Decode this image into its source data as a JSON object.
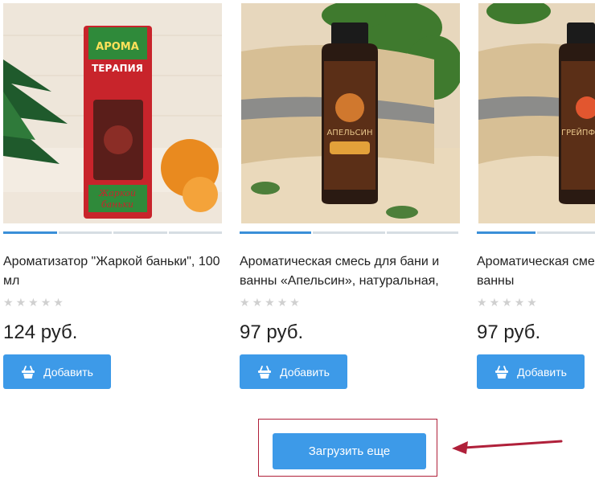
{
  "products": [
    {
      "title": "Ароматизатор \"Жаркой баньки\", 100 мл",
      "price": "124 руб.",
      "rating": 0,
      "add_label": "Добавить",
      "image": "aroma-box-with-tangerine-photo",
      "package_text": [
        "АРОМА",
        "ТЕРАПИЯ",
        "Жаркой",
        "баньки"
      ]
    },
    {
      "title": "Ароматическая смесь для бани и ванны «Апельсин», натуральная,",
      "price": "97 руб.",
      "rating": 0,
      "add_label": "Добавить",
      "image": "orange-bottle-photo",
      "package_text": [
        "АПЕЛЬСИН"
      ]
    },
    {
      "title": "Ароматическая сме ванны «Грейпфрут»",
      "price": "97 руб.",
      "rating": 0,
      "add_label": "Добавить",
      "image": "grapefruit-bottle-photo",
      "package_text": [
        "ГРЕЙПФ"
      ]
    }
  ],
  "load_more": {
    "label": "Загрузить еще"
  },
  "colors": {
    "accent": "#3d9ae8",
    "highlight": "#b0203a",
    "star": "#d0d0d0"
  }
}
